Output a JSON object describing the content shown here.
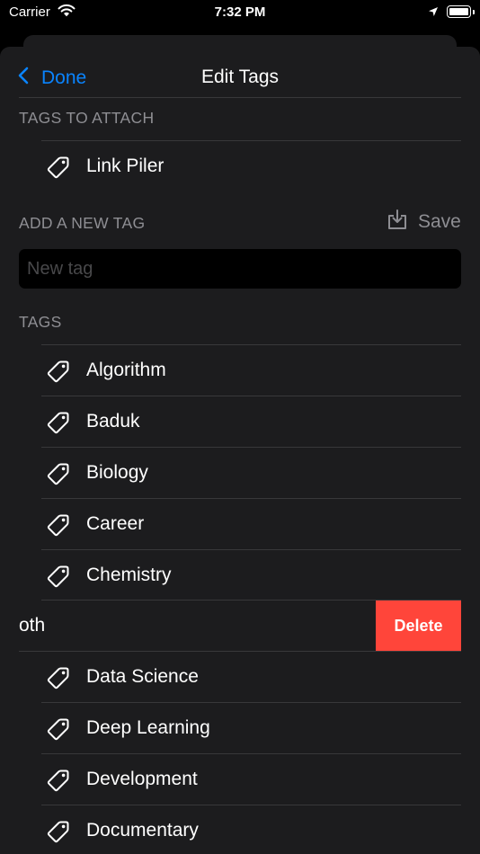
{
  "status_bar": {
    "carrier": "Carrier",
    "time": "7:32 PM"
  },
  "nav": {
    "back_label": "Done",
    "title": "Edit Tags"
  },
  "attach_section": {
    "header": "TAGS TO ATTACH",
    "items": [
      "Link Piler"
    ]
  },
  "new_tag_section": {
    "header": "ADD A NEW TAG",
    "save_label": "Save",
    "placeholder": "New tag"
  },
  "tags_section": {
    "header": "TAGS",
    "items_before": [
      "Algorithm",
      "Baduk",
      "Biology",
      "Career",
      "Chemistry"
    ],
    "swiped_item": {
      "visible_text": "oth",
      "delete_label": "Delete"
    },
    "items_after": [
      "Data Science",
      "Deep Learning",
      "Development",
      "Documentary"
    ]
  },
  "colors": {
    "accent": "#0a84ff",
    "destructive": "#ff453a",
    "background": "#1c1c1e",
    "secondary_text": "#8e8e93"
  }
}
